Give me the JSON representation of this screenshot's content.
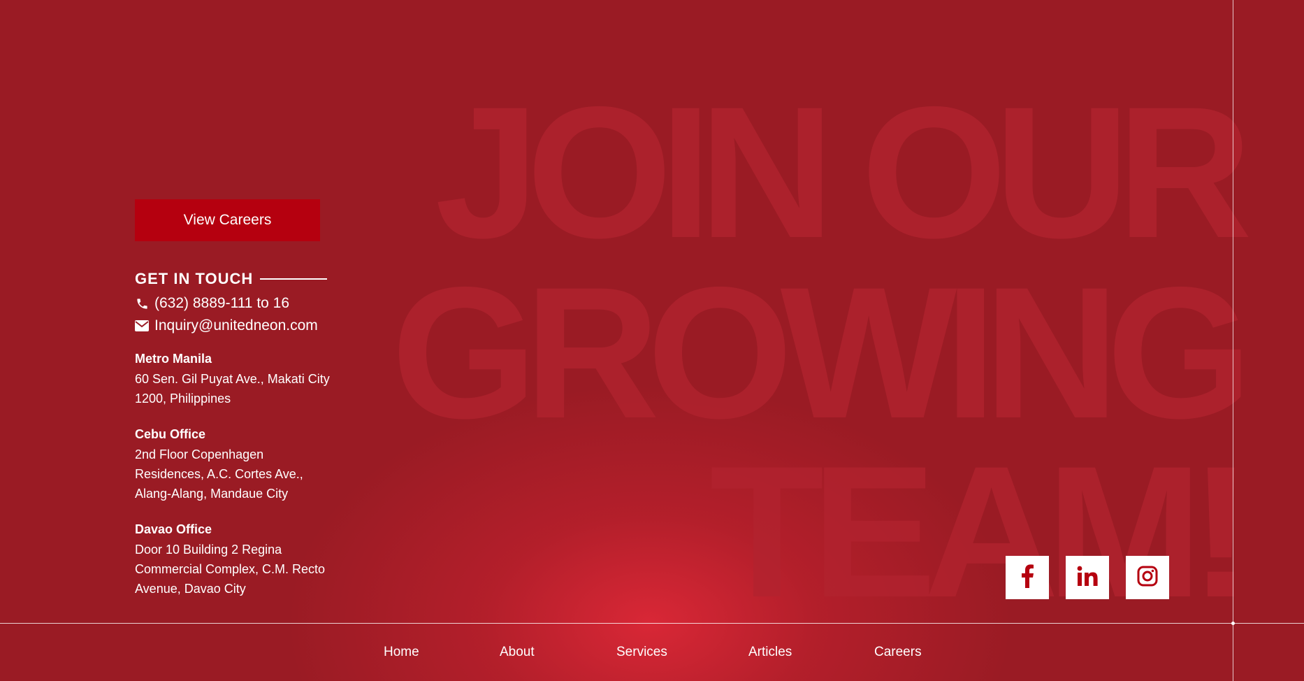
{
  "hero": {
    "line1": "JOIN OUR",
    "line2": "GROWING",
    "line3": "TEAM!"
  },
  "cta": {
    "view_careers_label": "View Careers"
  },
  "contact": {
    "heading": "GET IN TOUCH",
    "phone": "(632) 8889-111 to 16",
    "email": "Inquiry@unitedneon.com",
    "phone_icon": "phone-icon",
    "email_icon": "envelope-icon"
  },
  "offices": [
    {
      "name": "Metro Manila",
      "address": "60 Sen. Gil Puyat Ave., Makati City\n1200, Philippines"
    },
    {
      "name": "Cebu Office",
      "address": "2nd Floor Copenhagen\nResidences, A.C. Cortes Ave.,\nAlang-Alang, Mandaue City"
    },
    {
      "name": "Davao Office",
      "address": "Door 10 Building 2 Regina\nCommercial Complex, C.M. Recto\nAvenue, Davao City"
    }
  ],
  "social": [
    {
      "icon": "facebook-icon"
    },
    {
      "icon": "linkedin-icon"
    },
    {
      "icon": "instagram-icon"
    }
  ],
  "footer_nav": {
    "home": "Home",
    "about": "About",
    "services": "Services",
    "articles": "Articles",
    "careers": "Careers"
  },
  "colors": {
    "background": "#9a1b24",
    "accent": "#b5000f",
    "glow": "#d2222f",
    "watermark": "#b2232f"
  }
}
